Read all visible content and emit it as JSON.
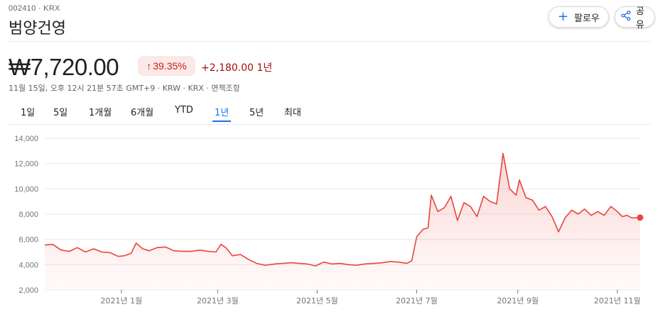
{
  "header": {
    "ticker_line": "002410 · KRX",
    "company_name": "범양건영",
    "follow_label": "팔로우",
    "share_label": "공유"
  },
  "quote": {
    "price": "₩7,720.00",
    "percent_change": "39.35%",
    "abs_change": "+2,180.00 1년",
    "meta": "11월 15일, 오후 12시 21분 57초 GMT+9 · KRW · KRX · 면책조항"
  },
  "tabs": [
    {
      "label": "1일"
    },
    {
      "label": "5일"
    },
    {
      "label": "1개월"
    },
    {
      "label": "6개월"
    },
    {
      "label": "YTD"
    },
    {
      "label": "1년",
      "active": true
    },
    {
      "label": "5년"
    },
    {
      "label": "최대"
    }
  ],
  "colors": {
    "line": "#e8453c",
    "fill": "#fce8e6",
    "accent": "#1a73e8",
    "negative_text": "#a50e0e"
  },
  "chart_data": {
    "type": "area",
    "title": "",
    "xlabel": "",
    "ylabel": "",
    "ylim": [
      2000,
      14000
    ],
    "yticks": [
      2000,
      4000,
      6000,
      8000,
      10000,
      12000,
      14000
    ],
    "ytick_labels": [
      "2,000",
      "4,000",
      "6,000",
      "8,000",
      "10,000",
      "12,000",
      "14,000"
    ],
    "xtick_labels": [
      "2021년 1월",
      "2021년 3월",
      "2021년 5월",
      "2021년 7월",
      "2021년 9월",
      "2021년 11월"
    ],
    "xticks": [
      "2021-01-01",
      "2021-03-01",
      "2021-05-01",
      "2021-07-01",
      "2021-09-01",
      "2021-11-01"
    ],
    "x_range": [
      "2020-11-15",
      "2021-11-15"
    ],
    "grid": "horizontal",
    "series": [
      {
        "x": [
          "2020-11-15",
          "2020-11-20",
          "2020-11-25",
          "2020-11-30",
          "2020-12-05",
          "2020-12-10",
          "2020-12-15",
          "2020-12-20",
          "2020-12-25",
          "2020-12-30",
          "2021-01-03",
          "2021-01-07",
          "2021-01-10",
          "2021-01-14",
          "2021-01-18",
          "2021-01-23",
          "2021-01-28",
          "2021-02-02",
          "2021-02-08",
          "2021-02-13",
          "2021-02-18",
          "2021-02-23",
          "2021-02-28",
          "2021-03-03",
          "2021-03-06",
          "2021-03-10",
          "2021-03-15",
          "2021-03-20",
          "2021-03-25",
          "2021-03-30",
          "2021-04-05",
          "2021-04-10",
          "2021-04-15",
          "2021-04-20",
          "2021-04-25",
          "2021-04-30",
          "2021-05-05",
          "2021-05-10",
          "2021-05-15",
          "2021-05-20",
          "2021-05-25",
          "2021-05-30",
          "2021-06-05",
          "2021-06-10",
          "2021-06-15",
          "2021-06-20",
          "2021-06-25",
          "2021-06-28",
          "2021-07-01",
          "2021-07-05",
          "2021-07-08",
          "2021-07-10",
          "2021-07-14",
          "2021-07-18",
          "2021-07-22",
          "2021-07-26",
          "2021-07-30",
          "2021-08-03",
          "2021-08-07",
          "2021-08-11",
          "2021-08-15",
          "2021-08-19",
          "2021-08-23",
          "2021-08-27",
          "2021-08-31",
          "2021-09-02",
          "2021-09-06",
          "2021-09-10",
          "2021-09-14",
          "2021-09-18",
          "2021-09-22",
          "2021-09-26",
          "2021-09-30",
          "2021-10-04",
          "2021-10-08",
          "2021-10-12",
          "2021-10-16",
          "2021-10-20",
          "2021-10-24",
          "2021-10-28",
          "2021-11-01",
          "2021-11-04",
          "2021-11-07",
          "2021-11-10",
          "2021-11-15"
        ],
        "values": [
          5550,
          5600,
          5150,
          5050,
          5350,
          5000,
          5250,
          5000,
          4950,
          4650,
          4700,
          4900,
          5700,
          5250,
          5100,
          5350,
          5400,
          5100,
          5050,
          5050,
          5150,
          5050,
          5000,
          5600,
          5350,
          4700,
          4800,
          4400,
          4100,
          3950,
          4050,
          4100,
          4150,
          4100,
          4050,
          3900,
          4200,
          4050,
          4100,
          4000,
          3950,
          4050,
          4100,
          4150,
          4250,
          4200,
          4100,
          4300,
          6200,
          6800,
          6900,
          9500,
          8200,
          8500,
          9400,
          7500,
          8900,
          8600,
          7800,
          9400,
          9000,
          8800,
          12800,
          10000,
          9500,
          10700,
          9300,
          9100,
          8300,
          8600,
          7800,
          6600,
          7700,
          8300,
          8000,
          8400,
          7900,
          8200,
          7900,
          8600,
          8200,
          7800,
          7900,
          7700,
          7720
        ]
      }
    ]
  }
}
